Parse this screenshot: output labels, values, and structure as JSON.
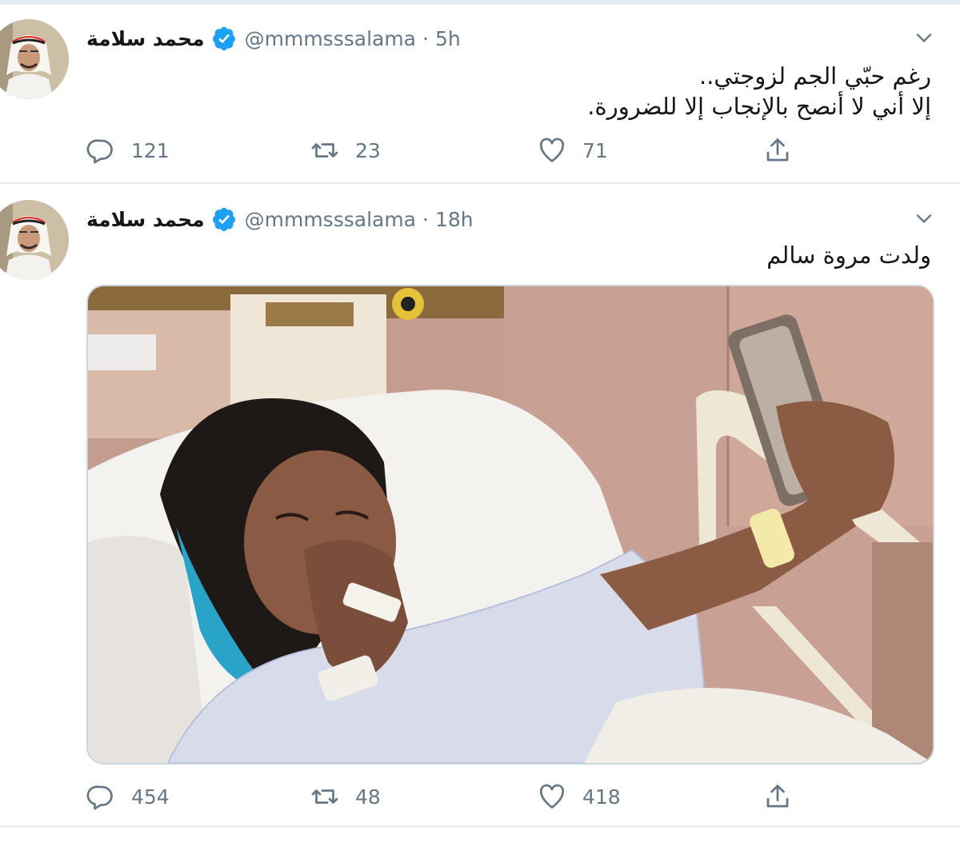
{
  "tweets": [
    {
      "author_name": "محمد سلامة",
      "handle": "@mmmsssalama",
      "separator": "·",
      "time": "5h",
      "text_lines": [
        "رغم حبّي الجم لزوجتي..",
        "إلا أني لا أنصح بالإنجاب إلا للضرورة."
      ],
      "replies": "121",
      "retweets": "23",
      "likes": "71"
    },
    {
      "author_name": "محمد سلامة",
      "handle": "@mmmsssalama",
      "separator": "·",
      "time": "18h",
      "text_lines": [
        "ولدت مروة سالم"
      ],
      "replies": "454",
      "retweets": "48",
      "likes": "418"
    }
  ],
  "icons": {
    "reply": "reply-icon",
    "retweet": "retweet-icon",
    "like": "heart-icon",
    "share": "share-icon",
    "verified": "verified-badge-icon",
    "menu": "chevron-down-icon"
  },
  "colors": {
    "verified": "#1da1f2",
    "secondary_text": "#657786",
    "divider": "#e6ecf0"
  }
}
